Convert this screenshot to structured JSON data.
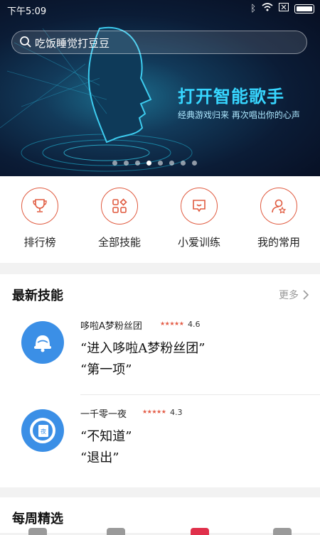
{
  "status_bar": {
    "time": "下午5:09"
  },
  "search": {
    "placeholder": "吃饭睡觉打豆豆"
  },
  "banner": {
    "title": "打开智能歌手",
    "subtitle": "经典游戏归来 再次唱出你的心声",
    "active_dot": 3,
    "dot_count": 8
  },
  "quick_actions": [
    {
      "label": "排行榜",
      "icon": "trophy-icon"
    },
    {
      "label": "全部技能",
      "icon": "grid-icon"
    },
    {
      "label": "小爱训练",
      "icon": "chat-bubble-icon"
    },
    {
      "label": "我的常用",
      "icon": "user-star-icon"
    }
  ],
  "latest_skills": {
    "title": "最新技能",
    "more_label": "更多",
    "items": [
      {
        "name": "哆啦A梦粉丝团",
        "stars": "★★★★★",
        "rating": "4.6",
        "phrase1": "“进入哆啦A梦粉丝团”",
        "phrase2": "“第一项”",
        "icon": "bell-icon"
      },
      {
        "name": "一千零一夜",
        "stars": "★★★★★",
        "rating": "4.3",
        "phrase1": "“不知道”",
        "phrase2": "“退出”",
        "icon": "book-icon"
      }
    ]
  },
  "weekly": {
    "title": "每周精选"
  },
  "colors": {
    "accent": "#e05a3f",
    "banner_text": "#37d6ff",
    "skill_blue": "#3b8fe6"
  }
}
